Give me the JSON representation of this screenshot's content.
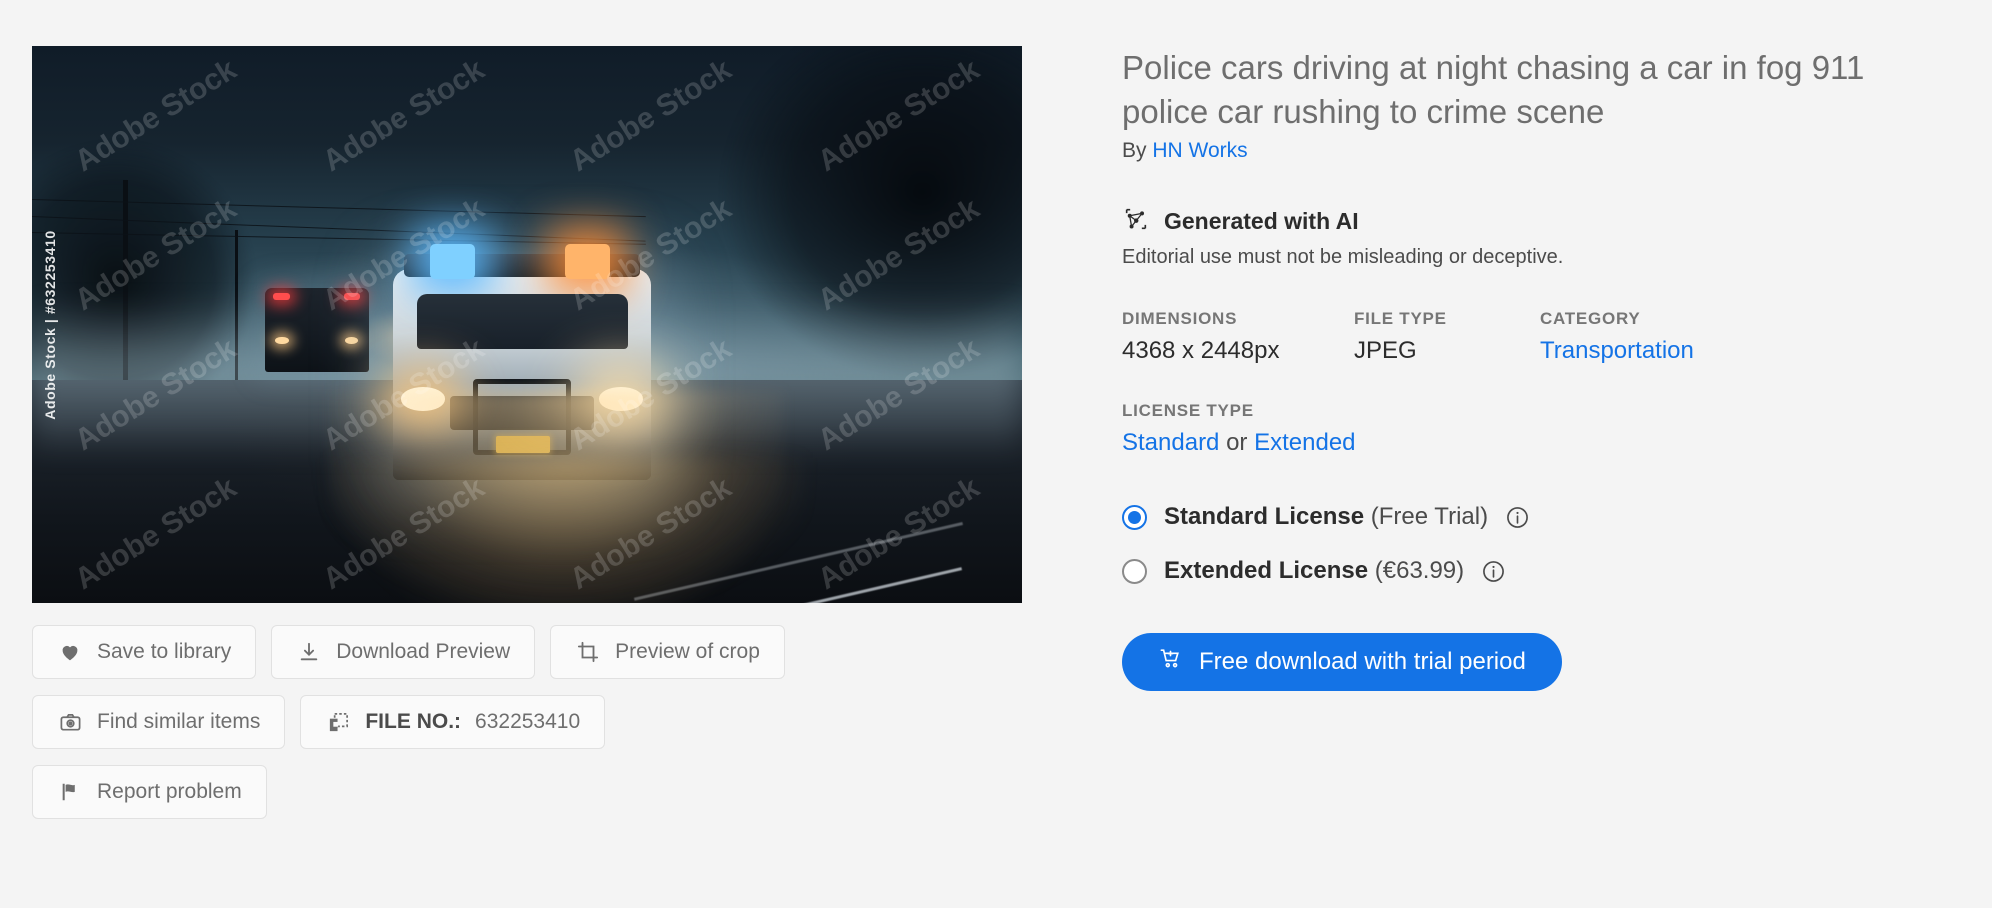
{
  "asset": {
    "title": "Police cars driving at night chasing a car in fog 911 police car rushing to crime scene",
    "by_prefix": "By",
    "author": "HN Works",
    "watermark_side": "Adobe Stock | #632253410",
    "watermark_tile": "Adobe Stock"
  },
  "ai_badge": {
    "label": "Generated with AI",
    "note": "Editorial use must not be misleading or deceptive."
  },
  "meta": {
    "dimensions_label": "DIMENSIONS",
    "dimensions_value": "4368 x 2448px",
    "filetype_label": "FILE TYPE",
    "filetype_value": "JPEG",
    "category_label": "CATEGORY",
    "category_value": "Transportation"
  },
  "license": {
    "type_label": "LICENSE TYPE",
    "standard_link": "Standard",
    "or_text": "or",
    "extended_link": "Extended"
  },
  "license_options": [
    {
      "name": "Standard License",
      "price": "(Free Trial)",
      "selected": true,
      "info_icon": "info-circle-icon"
    },
    {
      "name": "Extended License",
      "price": "(€63.99)",
      "selected": false,
      "info_icon": "info-circle-icon"
    }
  ],
  "cta": {
    "label": "Free download with trial period",
    "icon": "shopping-cart-icon"
  },
  "actions": {
    "save": {
      "label": "Save to library",
      "icon": "heart-icon"
    },
    "download_preview": {
      "label": "Download Preview",
      "icon": "download-icon"
    },
    "preview_crop": {
      "label": "Preview of crop",
      "icon": "crop-icon"
    },
    "find_similar": {
      "label": "Find similar items",
      "icon": "camera-icon"
    },
    "file_no_label": "FILE NO.:",
    "file_no_value": "632253410",
    "file_no_icon": "asset-copy-icon",
    "report": {
      "label": "Report problem",
      "icon": "flag-icon"
    }
  },
  "colors": {
    "accent_blue": "#1473e6",
    "page_bg": "#f4f4f4",
    "text_dark": "#2c2c2c",
    "text_muted": "#6e6e6e"
  }
}
